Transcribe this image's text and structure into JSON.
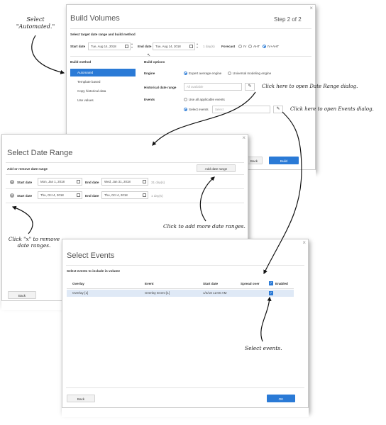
{
  "annotations": {
    "select_automated": "Select \"Automated.\"",
    "open_date_range": "Click here to open Date Range dialog.",
    "open_events": "Click here to open Events dialog.",
    "add_more_ranges": "Click to add more date ranges.",
    "remove_ranges": "Click \"x\" to remove date ranges.",
    "select_events": "Select events."
  },
  "build_volumes": {
    "title": "Build Volumes",
    "step": "Step 2 of 2",
    "target_heading": "Select target date range and build method",
    "start_label": "Start date",
    "start_value": "Tue, Aug 14, 2018",
    "end_label": "End date",
    "end_value": "Tue, Aug 14, 2018",
    "days": "1 day(s)",
    "forecast_label": "Forecast",
    "forecast_options": [
      "IV",
      "AHT",
      "IV+AHT"
    ],
    "build_method_heading": "Build method",
    "methods": [
      "Automated",
      "Template based",
      "Copy historical data",
      "Use values"
    ],
    "build_options_heading": "Build options",
    "engine_label": "Engine",
    "engine_options": [
      "Expert average engine",
      "Universal modeling engine"
    ],
    "hist_label": "Historical date range",
    "hist_placeholder": "All available",
    "events_label": "Events",
    "events_options": [
      "Use all applicable events",
      "Select events"
    ],
    "events_placeholder": "Select",
    "back": "Back",
    "build": "Build"
  },
  "date_range": {
    "title": "Select Date Range",
    "heading": "Add or remove date range",
    "add_button": "Add date range",
    "rows": [
      {
        "start_label": "Start date",
        "start": "Mon, Jan 1, 2018",
        "end_label": "End date",
        "end": "Wed, Jan 31, 2018",
        "days": "31 day(s)"
      },
      {
        "start_label": "Start date",
        "start": "Thu, Oct 4, 2018",
        "end_label": "End date",
        "end": "Thu, Oct 4, 2018",
        "days": "1 day(s)"
      }
    ],
    "back": "Back"
  },
  "events": {
    "title": "Select Events",
    "heading": "Select events to include in volume",
    "columns": [
      "Overlay",
      "Event",
      "Start date",
      "Spread over",
      "Enabled"
    ],
    "rows": [
      {
        "overlay": "Overlay [1]",
        "event": "Overlay Event [1]",
        "start": "1/4/18 12:00 AM",
        "spread": ""
      }
    ],
    "back": "Back",
    "ok": "OK"
  }
}
